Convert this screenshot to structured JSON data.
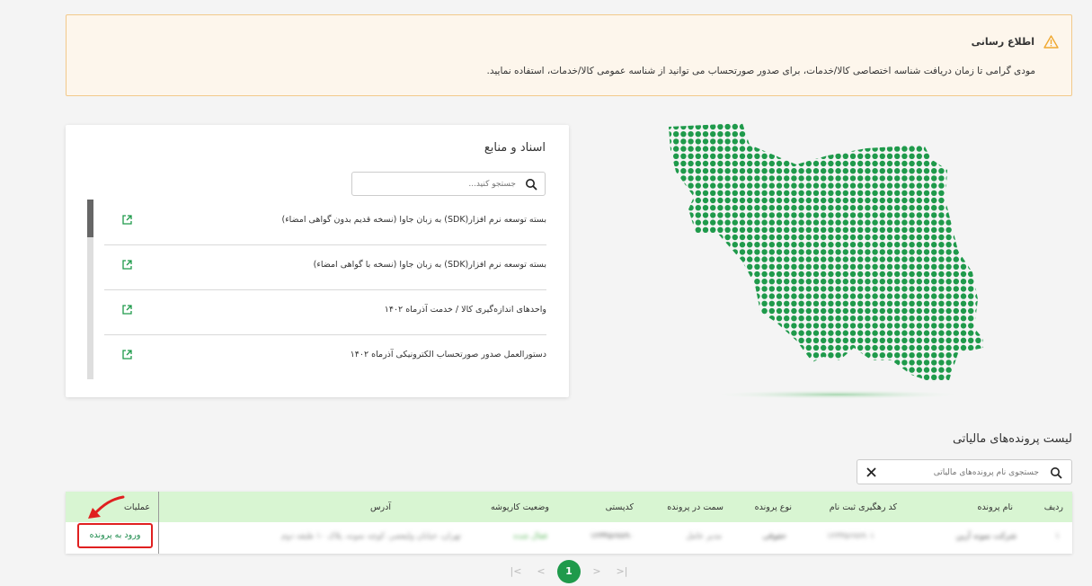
{
  "notice": {
    "title": "اطلاع رسانی",
    "text": "مودی گرامی تا زمان دریافت شناسه اختصاصی کالا/خدمات، برای صدور صورتحساب می توانید از شناسه عمومی کالا/خدمات، استفاده نمایید.",
    "icon": "warning-icon",
    "accent": "#f0a830"
  },
  "docs": {
    "title": "اسناد و منابع",
    "search_placeholder": "جستجو کنید...",
    "items": [
      {
        "label": "بسته توسعه نرم افزار(SDK) به زبان جاوا (نسخه قدیم بدون گواهی امضاء)"
      },
      {
        "label": "بسته توسعه نرم افزار(SDK) به زبان جاوا (نسخه با گواهی امضاء)"
      },
      {
        "label": "واحدهای اندازه‌گیری کالا / خدمت آذرماه ۱۴۰۲"
      },
      {
        "label": "دستورالعمل صدور صورتحساب الکترونیکی آذرماه ۱۴۰۲"
      }
    ]
  },
  "cases": {
    "title": "لیست پرونده‌های مالیاتی",
    "search_placeholder": "جستجوی نام پرونده‌های مالیاتی",
    "headers": {
      "row": "ردیف",
      "name": "نام پرونده",
      "tracking": "کد رهگیری ثبت نام",
      "type": "نوع پرونده",
      "role": "سمت در پرونده",
      "postal": "کدپستی",
      "status": "وضعیت کارپوشه",
      "address": "آدرس",
      "ops": "عملیات"
    },
    "rows": [
      {
        "row": "۱",
        "name": "شرکت نمونه آرین",
        "tracking": "۱۲۳۴۵۶۷۸۹۰۱",
        "type": "حقوقی",
        "role": "مدیر عامل",
        "postal": "۱۲۳۴۵۶۷۸۹۰",
        "status": "فعال شده",
        "address": "تهران، خیابان ولیعصر، کوچه نمونه، پلاک ۱۰ طبقه دوم",
        "enter_label": "ورود به پرونده"
      }
    ]
  },
  "pagination": {
    "current": "1"
  },
  "colors": {
    "primary": "#1f9a4b",
    "header_bg": "#d8f5d2",
    "highlight": "#e02020"
  }
}
